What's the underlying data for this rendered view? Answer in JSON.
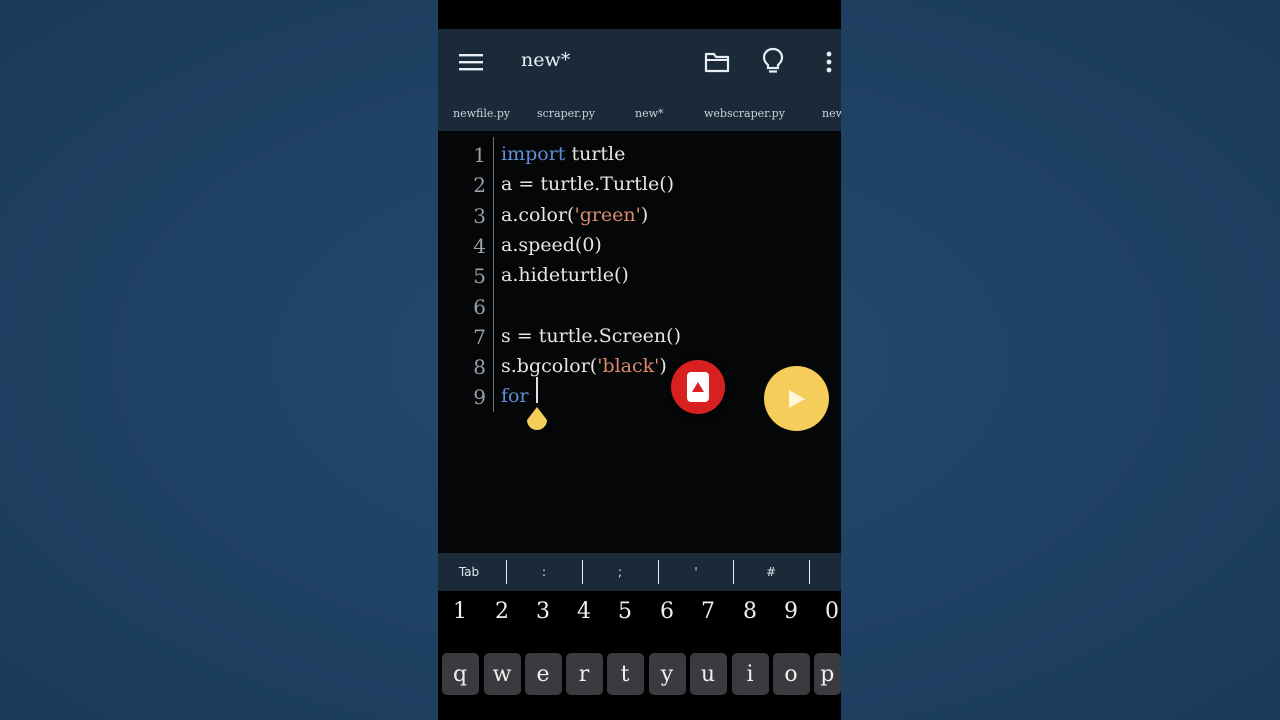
{
  "app_bar": {
    "title": "new*"
  },
  "tabs": [
    "newfile.py",
    "scraper.py",
    "new*",
    "webscraper.py",
    "new"
  ],
  "editor": {
    "line_numbers": [
      "1",
      "2",
      "3",
      "4",
      "5",
      "6",
      "7",
      "8",
      "9"
    ],
    "lines": [
      [
        {
          "t": "import",
          "c": "kw"
        },
        {
          "t": " turtle"
        }
      ],
      [
        {
          "t": "a = turtle.Turtle()"
        }
      ],
      [
        {
          "t": "a.color("
        },
        {
          "t": "'green'",
          "c": "str"
        },
        {
          "t": ")"
        }
      ],
      [
        {
          "t": "a.speed(0)"
        }
      ],
      [
        {
          "t": "a.hideturtle()"
        }
      ],
      [],
      [
        {
          "t": "s = turtle.Screen()"
        }
      ],
      [
        {
          "t": "s.bgcolor("
        },
        {
          "t": "'black'",
          "c": "str"
        },
        {
          "t": ")"
        }
      ],
      [
        {
          "t": "for",
          "c": "kw"
        },
        {
          "t": " "
        }
      ]
    ]
  },
  "symbol_bar": [
    "Tab",
    ":",
    ";",
    "'",
    "#"
  ],
  "keyboard": {
    "numbers": [
      "1",
      "2",
      "3",
      "4",
      "5",
      "6",
      "7",
      "8",
      "9",
      "0"
    ],
    "letters": [
      "q",
      "w",
      "e",
      "r",
      "t",
      "y",
      "u",
      "i",
      "o",
      "p"
    ]
  },
  "colors": {
    "background": "#1f4163",
    "app_bar": "#1b2a38",
    "editor_bg": "#050607",
    "keyword": "#5f8fd6",
    "string": "#d98b6b",
    "run_button": "#f5cd5b",
    "small_fab": "#d82020"
  },
  "icons": {
    "menu": "menu-icon",
    "folder": "folder-icon",
    "bulb": "lightbulb-icon",
    "more": "more-vert-icon",
    "run": "play-icon",
    "small_fab": "arrow-up-icon"
  }
}
